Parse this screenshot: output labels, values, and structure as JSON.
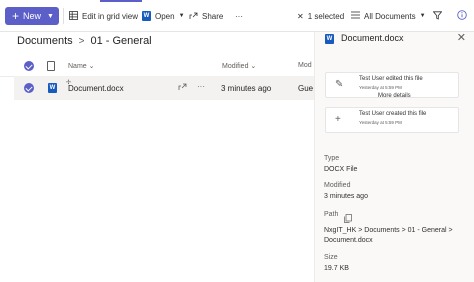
{
  "toolbar": {
    "new_label": "New",
    "edit_grid_label": "Edit in grid view",
    "open_label": "Open",
    "share_label": "Share",
    "more_label": "···",
    "selected_label": "1 selected",
    "all_documents_label": "All Documents"
  },
  "breadcrumb": {
    "root": "Documents",
    "separator": ">",
    "current": "01 - General"
  },
  "list": {
    "columns": {
      "name": "Name",
      "modified": "Modified",
      "modified_by": "Mod"
    },
    "rows": [
      {
        "name": "Document.docx",
        "modified": "3 minutes ago",
        "modified_by": "Gue"
      }
    ]
  },
  "details_panel": {
    "title": "Document.docx",
    "close": "✕",
    "activity": [
      {
        "text": "Test User edited this file",
        "time": "Yesterday at 5:59 PM",
        "icon": "pencil-icon"
      },
      {
        "text": "Test User created this file",
        "time": "Yesterday at 5:59 PM",
        "icon": "plus-icon"
      }
    ],
    "more_details": "More details",
    "type_label": "Type",
    "type_value": "DOCX File",
    "modified_label": "Modified",
    "modified_value": "3 minutes ago",
    "path_label": "Path",
    "path_line1": "NxgIT_HK > Documents > 01 - General >",
    "path_line2": "Document.docx",
    "size_label": "Size",
    "size_value": "19.7 KB"
  },
  "colors": {
    "accent": "#5b5fc7",
    "word_blue": "#185abd"
  }
}
